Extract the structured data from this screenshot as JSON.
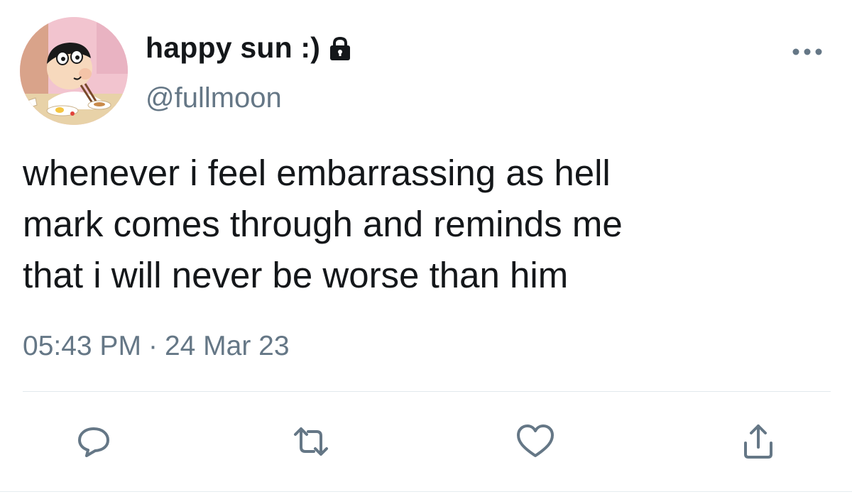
{
  "tweet": {
    "display_name": "happy sun :)",
    "handle": "@fullmoon",
    "text": "whenever i feel embarrassing as hell\nmark comes through and reminds me\nthat i will never be worse than him",
    "time": "05:43 PM",
    "separator": "·",
    "date": "24 Mar 23"
  },
  "icons": {
    "lock": "lock-icon",
    "more": "more-horizontal-icon",
    "reply": "reply-icon",
    "retweet": "retweet-icon",
    "like": "heart-icon",
    "share": "share-icon"
  },
  "colors": {
    "text": "#14171a",
    "secondary": "#657786",
    "accent": "#1da1f2",
    "divider": "#e1e8ed"
  }
}
